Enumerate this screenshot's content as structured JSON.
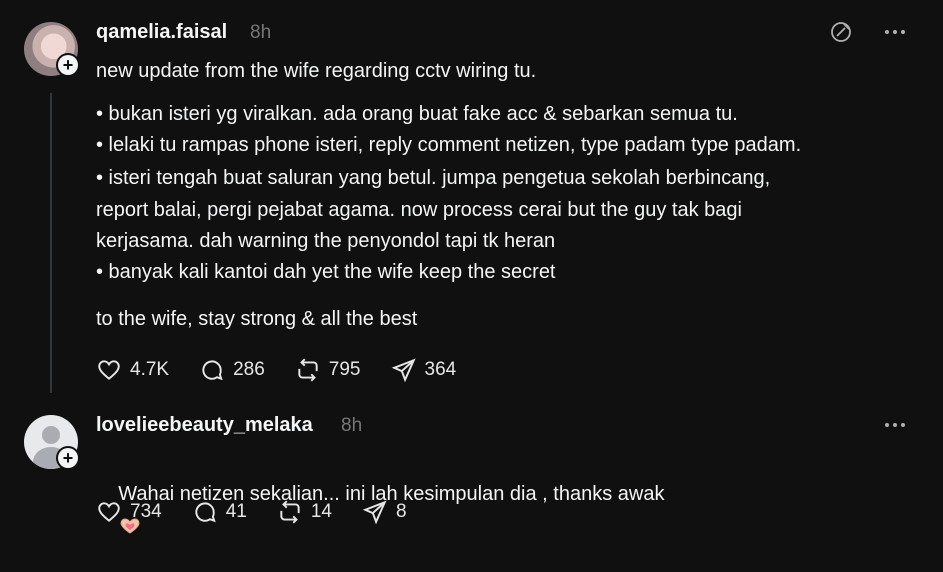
{
  "post1": {
    "username": "qamelia.faisal",
    "time": "8h",
    "intro": "new update from the wife regarding cctv wiring tu.",
    "bullets": [
      "• bukan isteri yg viralkan. ada orang buat fake acc & sebarkan semua tu.",
      "• lelaki tu rampas phone isteri, reply comment netizen, type padam type padam.",
      "• isteri tengah buat saluran yang betul. jumpa pengetua sekolah berbincang,",
      "report balai, pergi pejabat agama. now process cerai but the guy tak bagi",
      "kerjasama. dah warning the penyondol tapi tk heran",
      "• banyak kali kantoi dah yet the wife keep the secret"
    ],
    "closing": "to the wife, stay strong & all the best",
    "likes": "4.7K",
    "comments": "286",
    "reposts": "795",
    "shares": "364"
  },
  "post2": {
    "username": "lovelieebeauty_melaka",
    "time": "8h",
    "text": "Wahai netizen sekalian... ini lah kesimpulan dia , thanks awak",
    "likes": "734",
    "comments": "41",
    "reposts": "14",
    "shares": "8"
  },
  "icons": {
    "like": "heart-icon",
    "comment": "comment-icon",
    "repost": "repost-icon",
    "share": "share-icon",
    "more": "more-icon",
    "translate": "translate-icon",
    "follow": "plus-icon"
  },
  "colors": {
    "background": "#101010",
    "text": "#f3f5f7",
    "muted": "#777777"
  }
}
